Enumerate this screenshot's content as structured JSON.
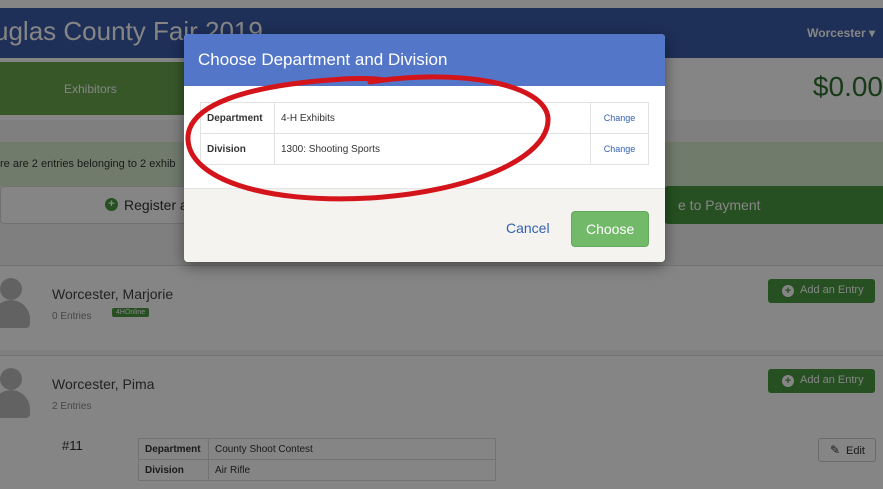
{
  "nav": {
    "title": "uglas County Fair 2019",
    "user": "Worcester ▾"
  },
  "tabs": {
    "exhibitors": "Exhibitors"
  },
  "cart": {
    "total": "$0.00"
  },
  "notice": {
    "text": "re are 2 entries belonging to 2 exhib"
  },
  "actions": {
    "register_label": "Register a",
    "payment_label": "e to Payment"
  },
  "exhibitors": [
    {
      "name": "Worcester, Marjorie",
      "entries": "0 Entries",
      "badge": "4HOnline",
      "add_label": "Add an Entry"
    },
    {
      "name": "Worcester, Pima",
      "entries": "2 Entries",
      "add_label": "Add an Entry",
      "entry": {
        "number": "#11",
        "rows": [
          {
            "key": "Department",
            "value": "County Shoot Contest"
          },
          {
            "key": "Division",
            "value": "Air Rifle"
          }
        ],
        "edit_label": "Edit"
      }
    }
  ],
  "modal": {
    "title": "Choose Department and Division",
    "rows": [
      {
        "key": "Department",
        "value": "4-H Exhibits",
        "action": "Change"
      },
      {
        "key": "Division",
        "value": "1300: Shooting Sports",
        "action": "Change"
      }
    ],
    "cancel_label": "Cancel",
    "choose_label": "Choose"
  },
  "colors": {
    "nav_blue": "#3b5ba9",
    "modal_header": "#5376c8",
    "brand_green": "#4a9a40",
    "choose_green": "#73b96a",
    "annotation_red": "#d4141b"
  },
  "icons": {
    "register": "plus-circle-icon",
    "add_entry": "plus-circle-icon",
    "edit": "pencil-icon",
    "avatar": "user-silhouette-icon"
  }
}
